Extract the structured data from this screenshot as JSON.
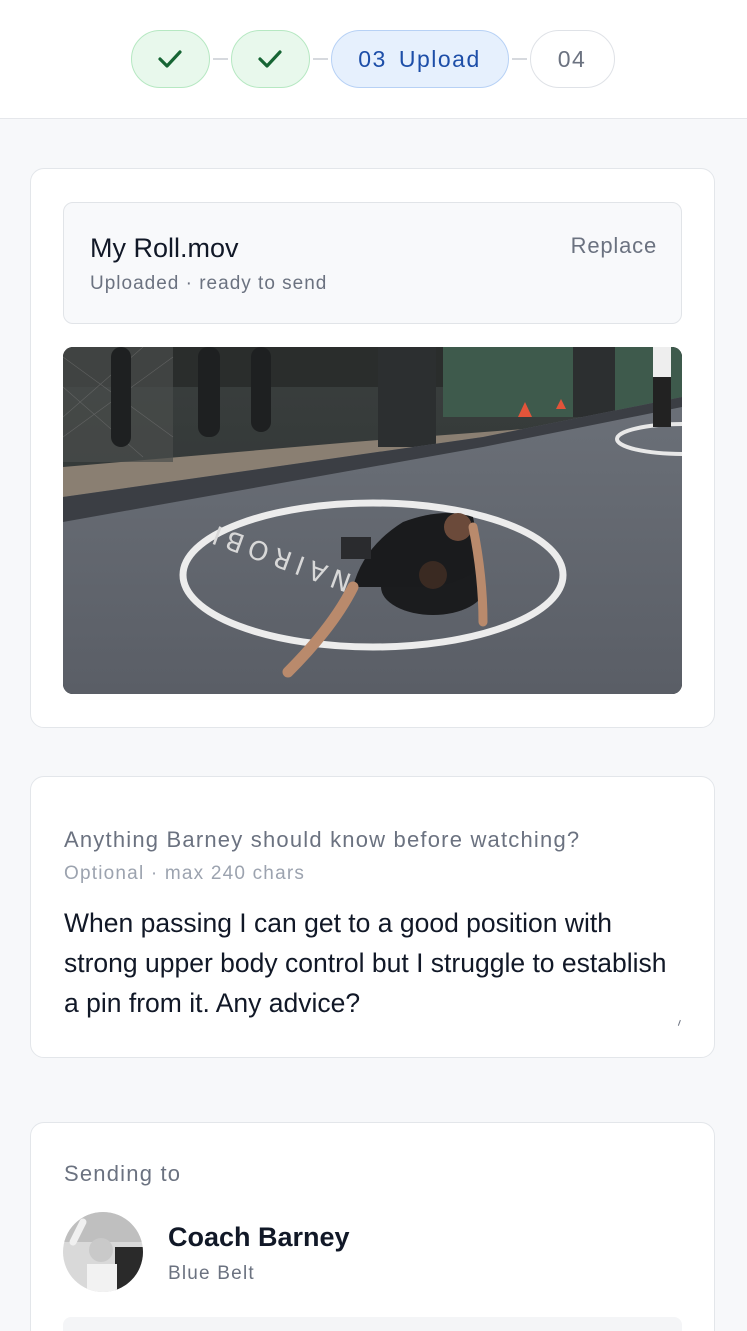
{
  "stepper": {
    "steps": [
      {
        "state": "done",
        "icon": "check-icon"
      },
      {
        "state": "done",
        "icon": "check-icon"
      },
      {
        "state": "active",
        "number": "03",
        "label": "Upload"
      },
      {
        "state": "todo",
        "number": "04"
      }
    ]
  },
  "upload": {
    "file_name": "My Roll.mov",
    "status": "Uploaded · ready to send",
    "replace_label": "Replace"
  },
  "notes": {
    "label": "Anything Barney should know before watching?",
    "hint": "Optional · max 240 chars",
    "value": "When passing I can get to a good position with strong upper body control but I struggle to establish a pin from it. Any advice?"
  },
  "recipient": {
    "section_label": "Sending to",
    "name": "Coach Barney",
    "rank": "Blue Belt"
  },
  "colors": {
    "done_fill": "#e8f8ec",
    "done_check": "#15803d",
    "active_fill": "#e6f0fd",
    "active_text": "#1d4ea8"
  }
}
